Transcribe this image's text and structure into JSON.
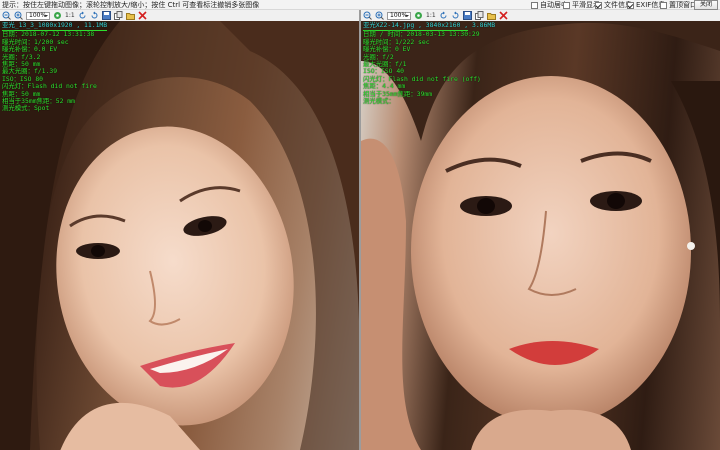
{
  "toolbar_top": {
    "hint": "提示：按住左键拖动图像；滚轮控制放大/缩小；按住 Ctrl 可查看标注撤销多张图像",
    "options": [
      {
        "label": "自动居中",
        "checked": false
      },
      {
        "label": "平滑显示",
        "checked": false
      },
      {
        "label": "文件信息",
        "checked": true
      },
      {
        "label": "EXIF信息",
        "checked": true
      },
      {
        "label": "置顶窗口",
        "checked": false
      }
    ],
    "close_label": "关闭"
  },
  "left": {
    "zoom": "100%",
    "ratio": "1:1",
    "exif_title": "亚光_13_3_1080x1920 , 11.1MB",
    "exif_lines": [
      "日期：2018-07-12 13:31:38",
      "曝光时间：1/200 sec",
      "曝光补偿：0.0 EV",
      "光圈：f/3.2",
      "焦距：50 mm",
      "最大光圈：f/1.39",
      "ISO：ISO 80",
      "闪光灯：Flash did not fire",
      "焦距：50 mm",
      "相当于35mm焦距：52 mm",
      "测光模式：Spot"
    ]
  },
  "right": {
    "zoom": "100%",
    "ratio": "1:1",
    "exif_title": "亚光XZ2-14.jpg , 3840x2160 , 3.86MB",
    "exif_lines": [
      "日期 / 时间：2018-03-13 13:30:29",
      "曝光时间：1/222 sec",
      "曝光补偿：0 EV",
      "光圈：f/2",
      "最大光圈：f/1",
      "ISO：ISO 40",
      "闪光灯：Flash did not fire (off)",
      "焦距：4.4 mm",
      "相当于35mm焦距：39mm",
      "测光模式："
    ]
  },
  "icons": [
    "zoom-out-icon",
    "zoom-in-icon",
    "fit-icon",
    "rotate-left-icon",
    "rotate-right-icon",
    "save-icon",
    "copy-icon",
    "open-icon",
    "delete-icon"
  ],
  "colors": {
    "exif_text": "#2ee02e",
    "exif_title": "#36d6d6",
    "delete_icon": "#d42020"
  }
}
